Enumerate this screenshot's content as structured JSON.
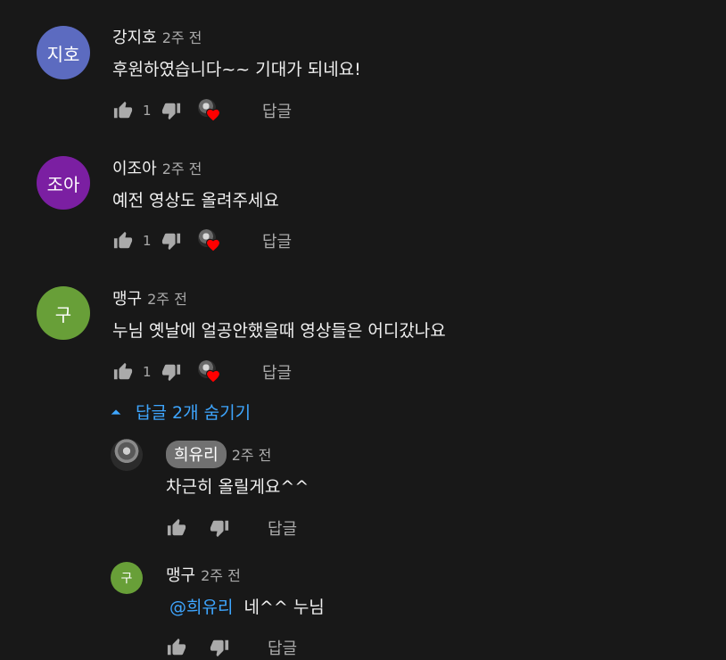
{
  "comments": [
    {
      "avatar_text": "지호",
      "avatar_color": "#5c6bc0",
      "author": "강지호",
      "time": "2주 전",
      "text": "후원하였습니다~~ 기대가 되네요!",
      "likes": "1",
      "reply_label": "답글"
    },
    {
      "avatar_text": "조아",
      "avatar_color": "#7b1fa2",
      "author": "이조아",
      "time": "2주 전",
      "text": "예전 영상도 올려주세요",
      "likes": "1",
      "reply_label": "답글"
    },
    {
      "avatar_text": "구",
      "avatar_color": "#689f38",
      "author": "맹구",
      "time": "2주 전",
      "text": "누님 옛날에 얼공안했을때 영상들은 어디갔나요",
      "likes": "1",
      "reply_label": "답글"
    }
  ],
  "replies_toggle": {
    "label": "답글 2개 숨기기",
    "icon": "chevron-up-icon"
  },
  "replies": [
    {
      "author": "희유리",
      "time": "2주 전",
      "text": "차근히 올릴게요^^",
      "reply_label": "답글"
    },
    {
      "avatar_text": "구",
      "avatar_color": "#689f38",
      "author": "맹구",
      "time": "2주 전",
      "mention": "@희유리",
      "text": "네^^ 누님",
      "reply_label": "답글"
    }
  ],
  "colors": {
    "background": "#181818",
    "link": "#3ea6ff",
    "heart": "#ff0000",
    "muted": "#aaaaaa"
  }
}
